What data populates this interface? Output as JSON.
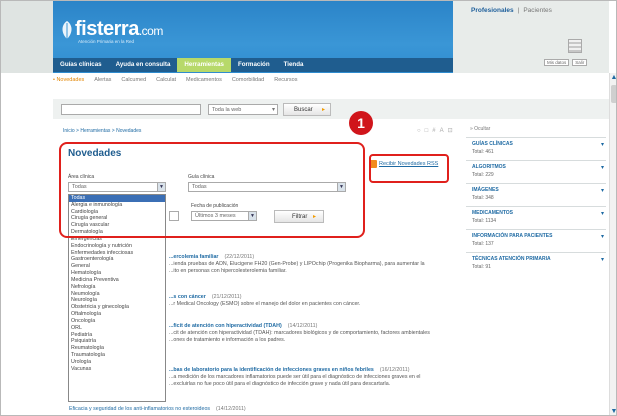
{
  "header": {
    "logo_text": "fisterra",
    "logo_domain": ".com",
    "logo_tagline": "Atención Primaria en la Red",
    "right_links": [
      "Profesionales",
      "Pacientes"
    ],
    "right_actions": [
      "Mis datos",
      "Salir"
    ]
  },
  "nav": {
    "items": [
      "Guías clínicas",
      "Ayuda en consulta",
      "Herramientas",
      "Formación",
      "Tienda"
    ],
    "active_index": 2
  },
  "subnav": {
    "items": [
      "• Novedades",
      "Alertas",
      "Calcumed",
      "Calculat",
      "Medicamentos",
      "Comorbilidad",
      "Recursos"
    ]
  },
  "search": {
    "scope": "Toda la web",
    "button": "Buscar"
  },
  "breadcrumb": "Inicio > Herramientas > Novedades",
  "page_title": "Novedades",
  "filters": {
    "area_label": "Área clínica",
    "area_value": "Todas",
    "guide_label": "Guía clínica",
    "guide_value": "Todas",
    "date_label": "Fecha de publicación",
    "date_value": "Últimos 3 meses",
    "filter_button": "Filtrar"
  },
  "area_options": [
    "Todas",
    "Alergia e inmunología",
    "Cardiología",
    "Cirugía general",
    "Cirugía vascular",
    "Dermatología",
    "Emergencias",
    "Endocrinología y nutrición",
    "Enfermedades infecciosas",
    "Gastroenterología",
    "General",
    "Hematología",
    "Medicina Preventiva",
    "Nefrología",
    "Neumología",
    "Neurología",
    "Obstetricia y ginecología",
    "Oftalmología",
    "Oncología",
    "ORL",
    "Pediatría",
    "Psiquiatría",
    "Reumatología",
    "Traumatología",
    "Urología",
    "Vacunas"
  ],
  "rss_link": "Recibir Novedades RSS",
  "callout_number": "1",
  "news": [
    {
      "title": "...ercolemia familiar",
      "date": "(22/12/2011)",
      "line2": "...ienda pruebas de ADN, Elucigene FH20 (Gen-Probe) y LIPOchip (Progenika Biopharma), para aumentar la",
      "line3": "...ito en personas con hipercolesterolemia familiar."
    },
    {
      "title": "...s con cáncer",
      "date": "(21/12/2011)",
      "line2": "...r Medical Oncology (ESMO) sobre el manejo del dolor en pacientes con cáncer.",
      "line3": ""
    },
    {
      "title": "...ficit de atención con hiperactividad (TDAH)",
      "date": "(14/12/2011)",
      "line2": "...cit de atención con hiperactividad (TDAH): marcadores biológicos y de comportamiento, factores ambientales",
      "line3": "...ones de tratamiento e información a los padres."
    },
    {
      "title": "...bas de laboratorio para la identificación de infecciones graves en niños febriles",
      "date": "(16/12/2011)",
      "line2": "...a medición de los marcadores inflamatorios puede ser útil para el diagnóstico de infecciones graves en el",
      "line3": "...excluirlas no fue poco útil para el diagnóstico de infección grave y nada útil para descartarla."
    },
    {
      "title": "Eficacia y seguridad de los anti-inflamatorios no esteroideos",
      "date": "(14/12/2011)",
      "line2": "",
      "line3": ""
    }
  ],
  "sidebar": {
    "header": "» Ocultar",
    "sections": [
      {
        "name": "Guías clínicas",
        "count": "Total: 461"
      },
      {
        "name": "Algoritmos",
        "count": "Total: 229"
      },
      {
        "name": "Imágenes",
        "count": "Total: 348"
      },
      {
        "name": "Medicamentos",
        "count": "Total: 1134"
      },
      {
        "name": "Información para pacientes",
        "count": "Total: 137"
      },
      {
        "name": "Técnicas atención primaria",
        "count": "Total: 91"
      }
    ]
  }
}
